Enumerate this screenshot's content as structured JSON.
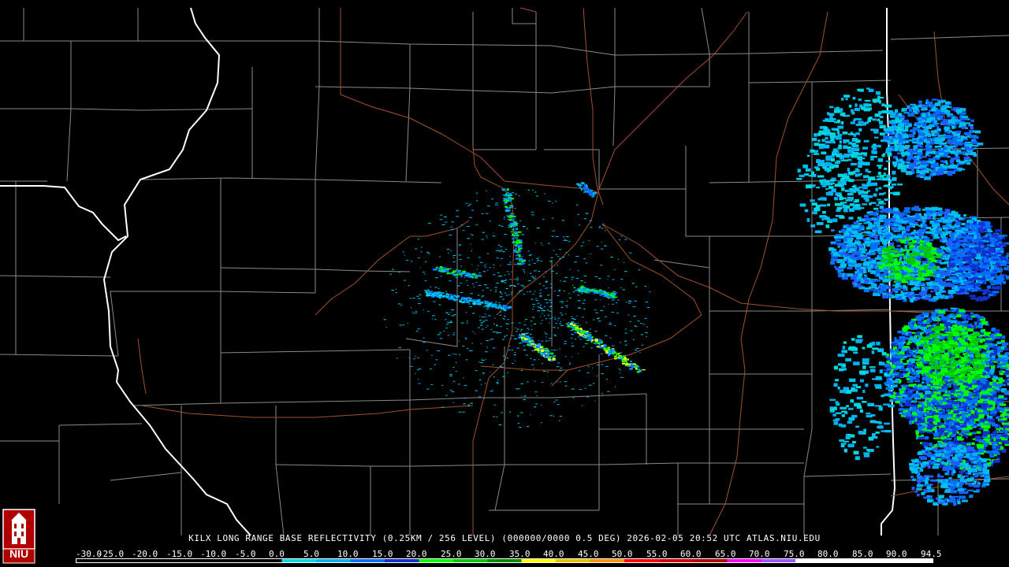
{
  "title": "KILX LONG RANGE BASE REFLECTIVITY (0.25KM / 256 LEVEL) (000000/0000 0.5 DEG) 2026-02-05 20:52 UTC  ATLAS.NIU.EDU",
  "logo": {
    "text": "NIU",
    "icon": "university-tower-icon"
  },
  "colorbar": {
    "labels": [
      "-30.0",
      "-25.0",
      "-20.0",
      "-15.0",
      "-10.0",
      "-5.0",
      "0.0",
      "5.0",
      "10.0",
      "15.0",
      "20.0",
      "25.0",
      "30.0",
      "35.0",
      "40.0",
      "45.0",
      "50.0",
      "55.0",
      "60.0",
      "65.0",
      "70.0",
      "75.0",
      "80.0",
      "85.0",
      "90.0",
      "94.5"
    ],
    "colors": [
      "#000000",
      "#000000",
      "#000000",
      "#000000",
      "#000000",
      "#000000",
      "#00d8e0",
      "#00b0f0",
      "#0070ff",
      "#1030d0",
      "#00ff00",
      "#00c800",
      "#008c00",
      "#ffff00",
      "#e6c000",
      "#ff9000",
      "#ff0000",
      "#d00000",
      "#b00000",
      "#ff00ff",
      "#9955ff",
      "#ffffff",
      "#ffffff",
      "#ffffff",
      "#ffffff"
    ]
  }
}
